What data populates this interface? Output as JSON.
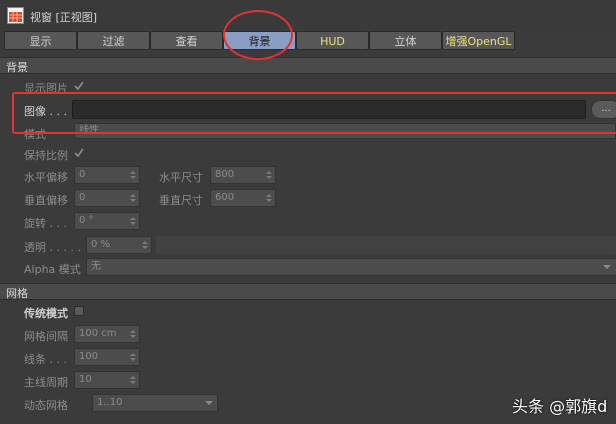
{
  "window": {
    "title": "视窗 [正视图]"
  },
  "tabs": [
    {
      "label": "显示"
    },
    {
      "label": "过滤"
    },
    {
      "label": "查看"
    },
    {
      "label": "背景"
    },
    {
      "label": "HUD"
    },
    {
      "label": "立体"
    },
    {
      "label": "增强OpenGL"
    }
  ],
  "background_section": {
    "title": "背景",
    "show_image_label": "显示图片",
    "image_label": "图像 . . .",
    "image_value": "",
    "browse_label": "...",
    "mode_label": "模式",
    "mode_value": "线性",
    "keep_ratio_label": "保持比例",
    "h_offset_label": "水平偏移",
    "h_offset_value": "0",
    "h_size_label": "水平尺寸",
    "h_size_value": "800",
    "v_offset_label": "垂直偏移",
    "v_offset_value": "0",
    "v_size_label": "垂直尺寸",
    "v_size_value": "600",
    "rotate_label": "旋转 . . .",
    "rotate_value": "0 °",
    "transparency_label": "透明 . . . . .",
    "transparency_value": "0 %",
    "alpha_label": "Alpha 模式",
    "alpha_value": "无"
  },
  "grid_section": {
    "title": "网格",
    "legacy_label": "传统模式",
    "spacing_label": "网格间隔",
    "spacing_value": "100 cm",
    "lines_label": "线条 . . .",
    "lines_value": "100",
    "major_label": "主线周期",
    "major_value": "10",
    "dynamic_label": "动态网格",
    "dynamic_value": "1..10"
  },
  "watermark": {
    "text": "头条 @郭旗d"
  },
  "colors": {
    "accent_tab": "#8a9ec4",
    "annotation": "#e23232"
  }
}
